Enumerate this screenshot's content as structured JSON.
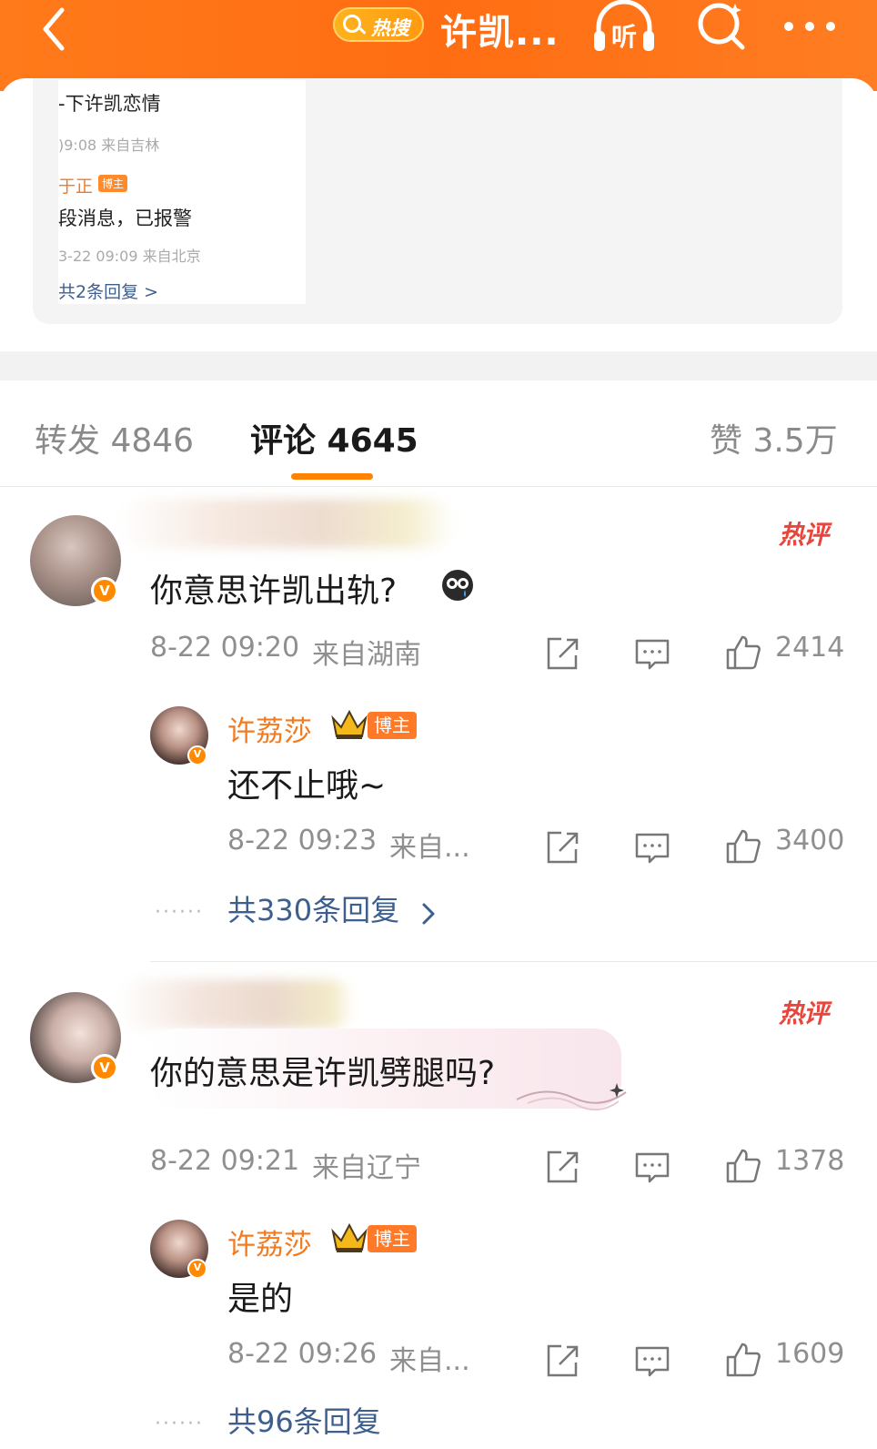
{
  "header": {
    "hot_badge": "热搜",
    "title": "许凯...",
    "listen_label": "听"
  },
  "quote": {
    "line1": "-下许凯恋情",
    "line2": ")9:08  来自吉林",
    "line3_name": "于正",
    "line3_badge": "博主",
    "line4": "段消息，已报警",
    "line5": "3-22 09:09  来自北京",
    "line6": "共2条回复 >"
  },
  "tabs": {
    "repost": "转发 4846",
    "comments": "评论 4645",
    "likes": "赞 3.5万"
  },
  "comments": [
    {
      "hot_tag": "热评",
      "text": "你意思许凯出轨?",
      "time": "8-22 09:20",
      "location": "来自湖南",
      "likes": "2414",
      "reply": {
        "name": "许荔莎",
        "badge": "博主",
        "text": "还不止哦~",
        "time": "8-22 09:23",
        "location": "来自...",
        "likes": "3400"
      },
      "more_replies": "共330条回复",
      "more_dots": "······"
    },
    {
      "hot_tag": "热评",
      "text": "你的意思是许凯劈腿吗?",
      "time": "8-22 09:21",
      "location": "来自辽宁",
      "likes": "1378",
      "reply": {
        "name": "许荔莎",
        "badge": "博主",
        "text": "是的",
        "time": "8-22 09:26",
        "location": "来自...",
        "likes": "1609"
      },
      "more_replies": "共96条回复",
      "more_dots": "······"
    }
  ],
  "colors": {
    "brand": "#ff7a1a",
    "username": "#f27b20",
    "hot_tag": "#e8453c",
    "link": "#3e5f8d"
  }
}
